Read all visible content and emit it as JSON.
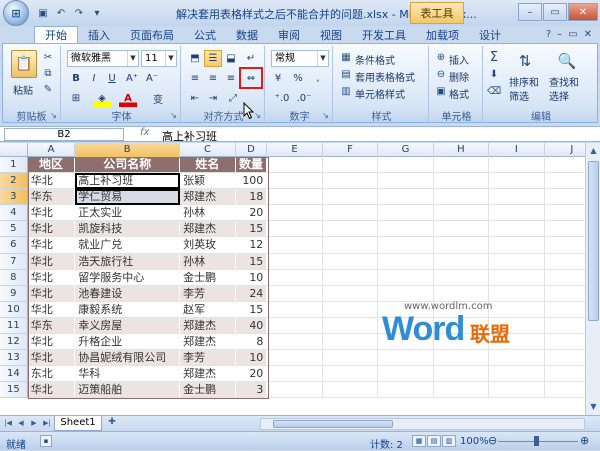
{
  "window": {
    "title": "解决套用表格样式之后不能合并的问题.xlsx - Microsoft Ex...",
    "context_tab": "表工具",
    "office_button_label": "⊞"
  },
  "tabs": [
    "开始",
    "插入",
    "页面布局",
    "公式",
    "数据",
    "审阅",
    "视图",
    "开发工具",
    "加载项",
    "设计"
  ],
  "active_tab": "开始",
  "ribbon": {
    "clipboard": {
      "label": "剪贴板",
      "paste": "粘贴"
    },
    "font": {
      "label": "字体",
      "font_name": "微软雅黑",
      "font_size": "11",
      "bold": "B",
      "italic": "I",
      "underline": "U",
      "color_a": "A",
      "wen": "变"
    },
    "alignment": {
      "label": "对齐方式"
    },
    "number": {
      "label": "数字",
      "format": "常规",
      "percent": "%"
    },
    "styles": {
      "label": "样式",
      "conditional": "条件格式",
      "table_style": "套用表格格式",
      "cell_style": "单元格样式"
    },
    "cells": {
      "label": "单元格",
      "insert": "插入",
      "delete": "删除",
      "format": "格式"
    },
    "editing": {
      "label": "编辑",
      "sum": "Σ",
      "sort": "排序和",
      "sort2": "筛选",
      "find": "查找和",
      "find2": "选择"
    }
  },
  "formula_bar": {
    "name_box": "B2",
    "fx": "fx",
    "content": "高上补习班"
  },
  "columns": [
    "A",
    "B",
    "C",
    "D",
    "E",
    "F",
    "G",
    "H",
    "I",
    "J"
  ],
  "selected_column": "B",
  "rows": [
    {
      "n": "1",
      "a": "地区",
      "b": "公司名称",
      "c": "姓名",
      "d": "数量"
    },
    {
      "n": "2",
      "a": "华北",
      "b": "高上补习班",
      "c": "张颖",
      "d": "100"
    },
    {
      "n": "3",
      "a": "华东",
      "b": "学仁贸易",
      "c": "郑建杰",
      "d": "18"
    },
    {
      "n": "4",
      "a": "华北",
      "b": "正太实业",
      "c": "孙林",
      "d": "20"
    },
    {
      "n": "5",
      "a": "华北",
      "b": "凯旋科技",
      "c": "郑建杰",
      "d": "15"
    },
    {
      "n": "6",
      "a": "华北",
      "b": "就业广兑",
      "c": "刘英玫",
      "d": "12"
    },
    {
      "n": "7",
      "a": "华北",
      "b": "浩天旅行社",
      "c": "孙林",
      "d": "15"
    },
    {
      "n": "8",
      "a": "华北",
      "b": "留学服务中心",
      "c": "金士鹏",
      "d": "10"
    },
    {
      "n": "9",
      "a": "华北",
      "b": "池春建设",
      "c": "李芳",
      "d": "24"
    },
    {
      "n": "10",
      "a": "华北",
      "b": "康毅系统",
      "c": "赵军",
      "d": "15"
    },
    {
      "n": "11",
      "a": "华东",
      "b": "幸义房屋",
      "c": "郑建杰",
      "d": "40"
    },
    {
      "n": "12",
      "a": "华北",
      "b": "升格企业",
      "c": "郑建杰",
      "d": "8"
    },
    {
      "n": "13",
      "a": "华北",
      "b": "协昌妮绒有限公司",
      "c": "李芳",
      "d": "10"
    },
    {
      "n": "14",
      "a": "东北",
      "b": "华科",
      "c": "郑建杰",
      "d": "20"
    },
    {
      "n": "15",
      "a": "华北",
      "b": "迈策船舶",
      "c": "金士鹏",
      "d": "3"
    }
  ],
  "sheet_tab": "Sheet1",
  "status": {
    "ready": "就绪",
    "count": "计数: 2",
    "zoom": "100%"
  },
  "watermark": {
    "url": "www.wordlm.com",
    "word": "Word",
    "cn": "联盟"
  }
}
